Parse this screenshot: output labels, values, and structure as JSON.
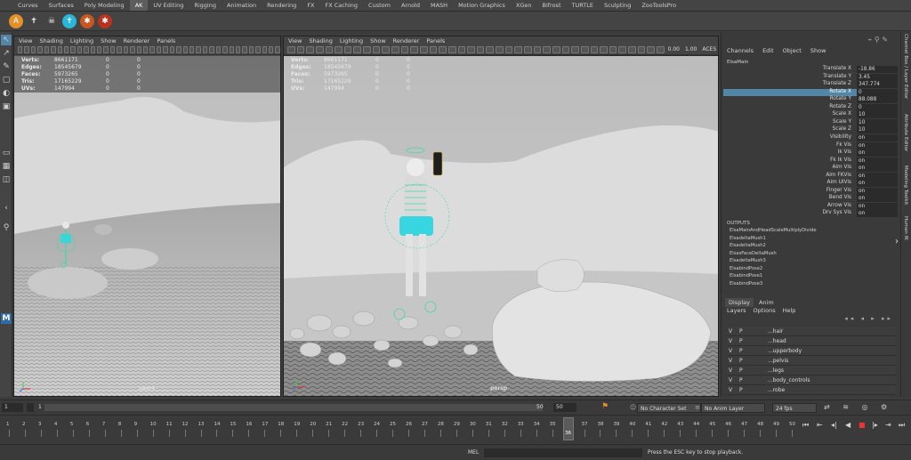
{
  "shelf": {
    "tabs": [
      "Curves",
      "Surfaces",
      "Poly Modeling",
      "AK",
      "UV Editing",
      "Rigging",
      "Animation",
      "Rendering",
      "FX",
      "FX Caching",
      "Custom",
      "Arnold",
      "MASH",
      "Motion Graphics",
      "XGen",
      "Bifrost",
      "TURTLE",
      "Sculpting",
      "ZooToolsPro"
    ],
    "active_tab": "AK",
    "icons": [
      {
        "name": "a-letter-icon",
        "glyph": "A",
        "color": "#e6902a"
      },
      {
        "name": "t-pose-figure-icon",
        "glyph": "✝",
        "color": "#444444"
      },
      {
        "name": "skull-icon",
        "glyph": "☠",
        "color": "#444444"
      },
      {
        "name": "t-pose-figure-cyan-icon",
        "glyph": "✝",
        "color": "#2ab6d9"
      },
      {
        "name": "character-orange-icon",
        "glyph": "✱",
        "color": "#c8561e"
      },
      {
        "name": "character-red-icon",
        "glyph": "✱",
        "color": "#b8321e"
      }
    ]
  },
  "viewport_left": {
    "menu": [
      "View",
      "Shading",
      "Lighting",
      "Show",
      "Renderer",
      "Panels"
    ],
    "hud": {
      "labels": [
        "Verts:",
        "Edges:",
        "Faces:",
        "Tris:",
        "UVs:"
      ],
      "values": [
        "8661171",
        "18545679",
        "5973265",
        "17165229",
        "147994"
      ],
      "col2": [
        "0",
        "0",
        "0",
        "0",
        "0"
      ],
      "col3": [
        "0",
        "0",
        "0",
        "0",
        "0"
      ]
    },
    "camera": "cam4"
  },
  "viewport_right": {
    "menu": [
      "View",
      "Shading",
      "Lighting",
      "Show",
      "Renderer",
      "Panels"
    ],
    "hud": {
      "labels": [
        "Verts:",
        "Edges:",
        "Faces:",
        "Tris:",
        "UVs:"
      ],
      "values": [
        "8661171",
        "18545679",
        "5973265",
        "17165229",
        "147994"
      ],
      "col2": [
        "0",
        "0",
        "0",
        "0",
        "0"
      ],
      "col3": [
        "0",
        "0",
        "0",
        "0",
        "0"
      ]
    },
    "toolbar_values": [
      "0.00",
      "1.00"
    ],
    "toolbar_label": "ACES",
    "camera": "persp"
  },
  "channel_box": {
    "menu": [
      "Channels",
      "Edit",
      "Object",
      "Show"
    ],
    "node": "ElsaMain",
    "attrs": [
      {
        "name": "Translate X",
        "value": "-18.86"
      },
      {
        "name": "Translate Y",
        "value": "3.45"
      },
      {
        "name": "Translate Z",
        "value": "347.774"
      },
      {
        "name": "Rotate X",
        "value": "0",
        "selected": true
      },
      {
        "name": "Rotate Y",
        "value": "88.088"
      },
      {
        "name": "Rotate Z",
        "value": "0"
      },
      {
        "name": "Scale X",
        "value": "10"
      },
      {
        "name": "Scale Y",
        "value": "10"
      },
      {
        "name": "Scale Z",
        "value": "10"
      },
      {
        "name": "Visibility",
        "value": "on"
      },
      {
        "name": "Fk Vis",
        "value": "on"
      },
      {
        "name": "Ik Vis",
        "value": "on"
      },
      {
        "name": "Fk Ik Vis",
        "value": "on"
      },
      {
        "name": "Aim Vis",
        "value": "on"
      },
      {
        "name": "Aim FKVis",
        "value": "on"
      },
      {
        "name": "Aim UIVis",
        "value": "on"
      },
      {
        "name": "Finger Vis",
        "value": "on"
      },
      {
        "name": "Bend Vis",
        "value": "on"
      },
      {
        "name": "Arrow Vis",
        "value": "on"
      },
      {
        "name": "Drv Sys Vis",
        "value": "on"
      }
    ],
    "outputs_title": "OUTPUTS",
    "outputs": [
      "ElsaMainAndHeadScaleMultiplyDivide",
      "ElsadeltaMush1",
      "ElsadeltaMush2",
      "ElsasFaceDeltaMush",
      "ElsadeltaMush3",
      "ElsabindPose2",
      "ElsabindPose1",
      "ElsabindPose3"
    ]
  },
  "side_tabs": [
    "Channel Box / Layer Editor",
    "Attribute Editor",
    "Modeling Toolkit",
    "Human IK"
  ],
  "layer_editor": {
    "tabs": [
      "Display",
      "Anim"
    ],
    "menu": [
      "Layers",
      "Options",
      "Help"
    ],
    "layers": [
      {
        "v": "V",
        "p": "P",
        "name": "...hair"
      },
      {
        "v": "V",
        "p": "P",
        "name": "...head"
      },
      {
        "v": "V",
        "p": "P",
        "name": "...upperbody"
      },
      {
        "v": "V",
        "p": "P",
        "name": "...pelvis"
      },
      {
        "v": "V",
        "p": "P",
        "name": "...legs"
      },
      {
        "v": "V",
        "p": "P",
        "name": "...body_controls"
      },
      {
        "v": "V",
        "p": "P",
        "name": "...robe"
      }
    ]
  },
  "range": {
    "start": "1",
    "start2": "1",
    "end": "50",
    "end2": "50",
    "character_set": "No Character Set",
    "anim_layer": "No Anim Layer",
    "fps": "24 fps"
  },
  "timeline": {
    "ticks": [
      "1",
      "2",
      "3",
      "4",
      "5",
      "6",
      "7",
      "8",
      "9",
      "10",
      "11",
      "12",
      "13",
      "14",
      "15",
      "16",
      "17",
      "18",
      "19",
      "20",
      "21",
      "22",
      "23",
      "24",
      "25",
      "26",
      "27",
      "28",
      "29",
      "30",
      "31",
      "32",
      "33",
      "34",
      "35",
      "36",
      "37",
      "38",
      "39",
      "40",
      "41",
      "42",
      "43",
      "44",
      "45",
      "46",
      "47",
      "48",
      "49",
      "50"
    ],
    "current_frame": "36",
    "current": 36
  },
  "command_line": {
    "label": "MEL",
    "help": "Press the ESC key to stop playback."
  }
}
